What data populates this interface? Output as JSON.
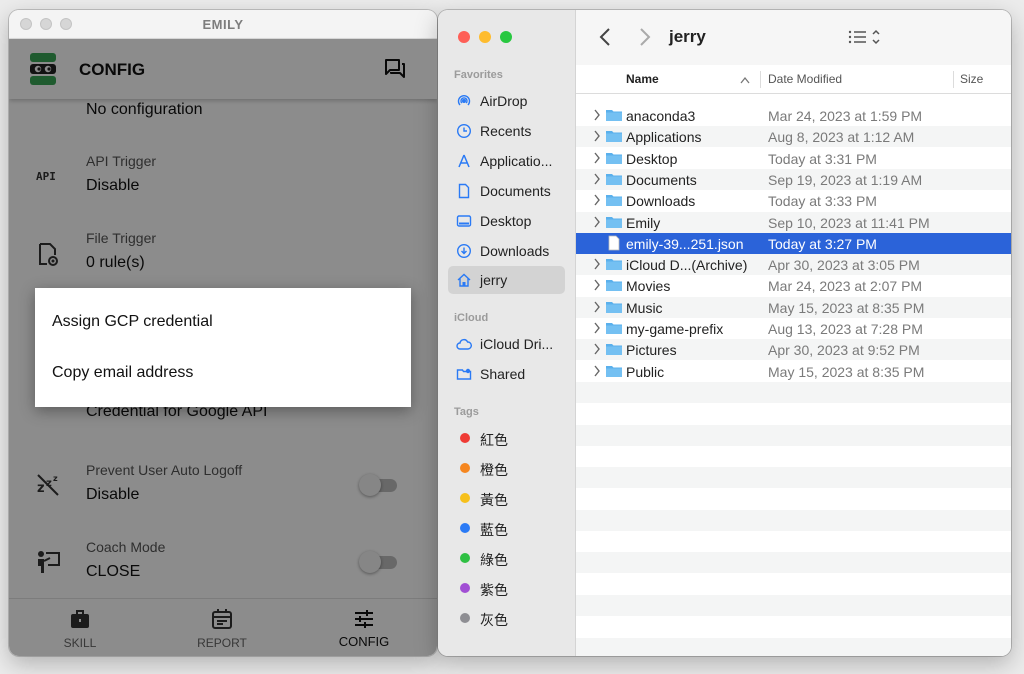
{
  "emily": {
    "window_title": "EMILY",
    "header_title": "CONFIG",
    "items": [
      {
        "label": "",
        "value": "No configuration"
      },
      {
        "label": "API Trigger",
        "value": "Disable"
      },
      {
        "label": "File Trigger",
        "value": "0 rule(s)"
      },
      {
        "label": "",
        "value": "Credential for Google API"
      },
      {
        "label": "Prevent User Auto Logoff",
        "value": "Disable",
        "toggle": false
      },
      {
        "label": "Coach Mode",
        "value": "CLOSE",
        "toggle": false
      }
    ],
    "popup": [
      "Assign GCP credential",
      "Copy email address"
    ],
    "nav": [
      {
        "label": "SKILL",
        "icon": "briefcase-icon"
      },
      {
        "label": "REPORT",
        "icon": "calendar-icon"
      },
      {
        "label": "CONFIG",
        "icon": "tune-icon",
        "active": true
      }
    ],
    "accent_color": "#3aa757"
  },
  "finder": {
    "title": "jerry",
    "sidebar": {
      "favorites_header": "Favorites",
      "favorites": [
        {
          "label": "AirDrop",
          "icon": "airdrop-icon"
        },
        {
          "label": "Recents",
          "icon": "clock-icon"
        },
        {
          "label": "Applicatio...",
          "icon": "applications-icon"
        },
        {
          "label": "Documents",
          "icon": "document-icon"
        },
        {
          "label": "Desktop",
          "icon": "desktop-icon"
        },
        {
          "label": "Downloads",
          "icon": "download-icon"
        },
        {
          "label": "jerry",
          "icon": "home-icon",
          "selected": true
        }
      ],
      "icloud_header": "iCloud",
      "icloud": [
        {
          "label": "iCloud Dri...",
          "icon": "cloud-icon"
        },
        {
          "label": "Shared",
          "icon": "shared-folder-icon"
        }
      ],
      "tags_header": "Tags",
      "tags": [
        {
          "label": "紅色",
          "color": "#ef3b35"
        },
        {
          "label": "橙色",
          "color": "#f5861f"
        },
        {
          "label": "黃色",
          "color": "#f6c01b"
        },
        {
          "label": "藍色",
          "color": "#2a7af5"
        },
        {
          "label": "綠色",
          "color": "#2fc043"
        },
        {
          "label": "紫色",
          "color": "#a14fd4"
        },
        {
          "label": "灰色",
          "color": "#8e8e93"
        }
      ]
    },
    "columns": {
      "name": "Name",
      "date": "Date Modified",
      "size": "Size"
    },
    "rows": [
      {
        "name": "anaconda3",
        "date": "Mar 24, 2023 at 1:59 PM",
        "type": "folder"
      },
      {
        "name": "Applications",
        "date": "Aug 8, 2023 at 1:12 AM",
        "type": "folder"
      },
      {
        "name": "Desktop",
        "date": "Today at 3:31 PM",
        "type": "folder"
      },
      {
        "name": "Documents",
        "date": "Sep 19, 2023 at 1:19 AM",
        "type": "folder"
      },
      {
        "name": "Downloads",
        "date": "Today at 3:33 PM",
        "type": "folder"
      },
      {
        "name": "Emily",
        "date": "Sep 10, 2023 at 11:41 PM",
        "type": "folder"
      },
      {
        "name": "emily-39...251.json",
        "date": "Today at 3:27 PM",
        "type": "file",
        "selected": true
      },
      {
        "name": "iCloud D...(Archive)",
        "date": "Apr 30, 2023 at 3:05 PM",
        "type": "folder"
      },
      {
        "name": "Movies",
        "date": "Mar 24, 2023 at 2:07 PM",
        "type": "folder"
      },
      {
        "name": "Music",
        "date": "May 15, 2023 at 8:35 PM",
        "type": "folder"
      },
      {
        "name": "my-game-prefix",
        "date": "Aug 13, 2023 at 7:28 PM",
        "type": "folder"
      },
      {
        "name": "Pictures",
        "date": "Apr 30, 2023 at 9:52 PM",
        "type": "folder"
      },
      {
        "name": "Public",
        "date": "May 15, 2023 at 8:35 PM",
        "type": "folder"
      }
    ],
    "selection_color": "#2b63d9",
    "folder_color": "#5ab0ec"
  }
}
